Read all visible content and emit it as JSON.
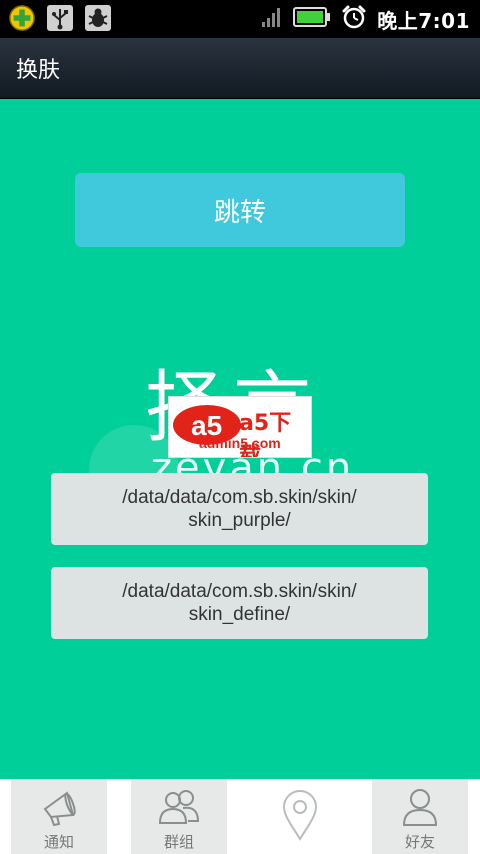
{
  "status_bar": {
    "time": "晚上7:01",
    "icons": [
      "add-app-icon",
      "usb-icon",
      "debug-bug-icon",
      "signal-icon",
      "battery-icon",
      "alarm-clock-icon"
    ]
  },
  "title_bar": {
    "title": "换肤"
  },
  "main": {
    "jump_button_label": "跳转",
    "skin_paths": [
      {
        "line1": "/data/data/com.sb.skin/skin/",
        "line2": "skin_purple/"
      },
      {
        "line1": "/data/data/com.sb.skin/skin/",
        "line2": "skin_define/"
      }
    ],
    "watermark": {
      "large_text": "择言",
      "small_text": "zeyan.cn",
      "logo_text": "a5下载",
      "logo_domain": "admin5.com"
    }
  },
  "tab_bar": {
    "tabs": [
      {
        "label": "通知",
        "icon": "megaphone-icon"
      },
      {
        "label": "群组",
        "icon": "group-icon"
      },
      {
        "label": "",
        "icon": "location-pin-icon"
      },
      {
        "label": "好友",
        "icon": "person-icon"
      }
    ]
  },
  "colors": {
    "background": "#00cf9a",
    "jump_button": "#40c8dd",
    "path_button": "#dde3e3",
    "tab_background": "#e6e9e8"
  }
}
